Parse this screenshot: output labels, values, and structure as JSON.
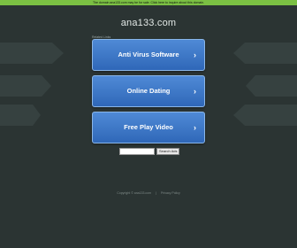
{
  "top_notice": "The domain ana133.com may be for sale. Click here to inquire about this domain.",
  "domain_title": "ana133.com",
  "related_label": "Related Links",
  "links": [
    {
      "label": "Anti Virus Software",
      "chevron": "›"
    },
    {
      "label": "Online Dating",
      "chevron": "›"
    },
    {
      "label": "Free Play Video",
      "chevron": "›"
    }
  ],
  "search": {
    "placeholder": "",
    "button_label": "Search Ads"
  },
  "footer": {
    "copyright": "Copyright © ana133.com",
    "separator": "|",
    "privacy": "Privacy Policy"
  },
  "colors": {
    "background": "#2b3433",
    "topbar": "#7bc043",
    "button": "#3d77c7"
  }
}
